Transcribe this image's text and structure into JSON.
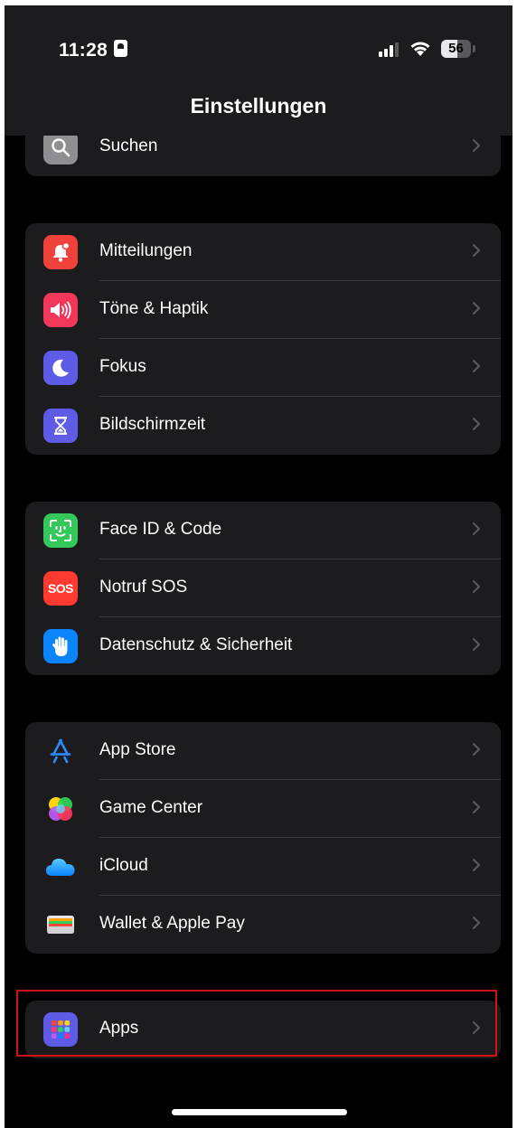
{
  "status": {
    "time": "11:28",
    "battery": "56"
  },
  "nav": {
    "title": "Einstellungen"
  },
  "group0": {
    "items": [
      {
        "label": "Suchen"
      }
    ]
  },
  "group1": {
    "items": [
      {
        "label": "Mitteilungen"
      },
      {
        "label": "Töne & Haptik"
      },
      {
        "label": "Fokus"
      },
      {
        "label": "Bildschirmzeit"
      }
    ]
  },
  "group2": {
    "items": [
      {
        "label": "Face ID & Code"
      },
      {
        "label": "Notruf SOS"
      },
      {
        "label": "Datenschutz & Sicherheit"
      }
    ]
  },
  "group3": {
    "items": [
      {
        "label": "App Store"
      },
      {
        "label": "Game Center"
      },
      {
        "label": "iCloud"
      },
      {
        "label": "Wallet & Apple Pay"
      }
    ]
  },
  "group4": {
    "items": [
      {
        "label": "Apps"
      }
    ]
  },
  "icons": {
    "sos_text": "SOS"
  },
  "colors": {
    "background": "#000000",
    "cell": "#1c1c1e",
    "notifications": "#f0413b",
    "sounds": "#f2385a",
    "focus": "#5e5ce6",
    "screentime": "#5e5ce6",
    "faceid": "#34c759",
    "sos": "#ff3b30",
    "privacy": "#0a84ff",
    "highlight": "#d01414"
  }
}
